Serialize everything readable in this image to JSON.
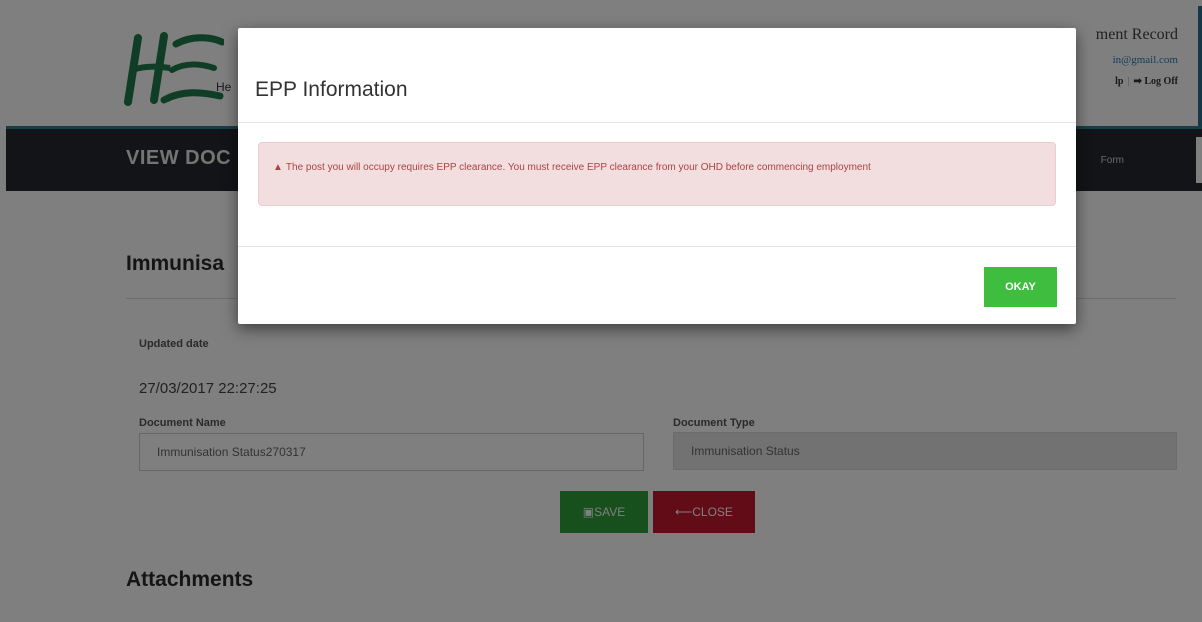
{
  "header": {
    "logo_letters": "HSE",
    "logo_subtitle": "He",
    "title_fragment": "ment Record",
    "email_fragment": "in@gmail.com",
    "help_fragment": "lp",
    "logoff_label": "Log Off"
  },
  "navbar": {
    "title": "VIEW DOC",
    "right_link": "Form"
  },
  "content": {
    "section_title": "Immunisa",
    "updated_date_label": "Updated date",
    "updated_date_value": "27/03/2017 22:27:25",
    "document_name_label": "Document Name",
    "document_name_value": "Immunisation Status270317",
    "document_type_label": "Document Type",
    "document_type_value": "Immunisation Status",
    "save_label": "SAVE",
    "close_label": "CLOSE",
    "attachments_title": "Attachments"
  },
  "modal": {
    "title": "EPP Information",
    "alert_text": "The post you will occupy requires EPP clearance. You must receive EPP clearance from your OHD before commencing employment",
    "okay_label": "OKAY"
  },
  "colors": {
    "navbar": "#24292e",
    "save_button": "#2e9e3b",
    "close_button": "#c2192c",
    "okay_button": "#3ebd3e",
    "alert_bg": "#f2dede",
    "alert_text": "#a94442"
  },
  "icons": {
    "alert": "warning-triangle-icon",
    "save": "floppy-disk-icon",
    "close": "arrow-left-icon",
    "logoff": "sign-out-icon"
  }
}
